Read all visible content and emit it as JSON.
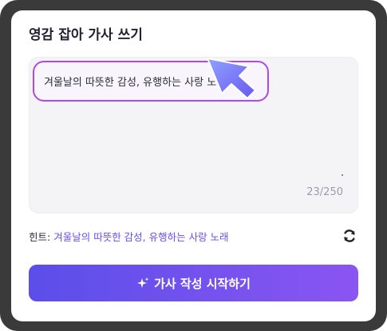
{
  "panel": {
    "title": "영감 잡아 가사 쓰기"
  },
  "lyric_input": {
    "value": "겨울날의 따뜻한 감성, 유행하는 사랑 노래",
    "char_count": "23/250"
  },
  "hint": {
    "label": "힌트:",
    "text": "겨울날의 따뜻한 감성, 유행하는 사랑 노래"
  },
  "start_button": {
    "label": "가사 작성 시작하기"
  },
  "icons": {
    "refresh": "refresh-icon",
    "sparkle": "sparkle-icon",
    "pointer": "pointer-arrow-icon"
  },
  "colors": {
    "accent": "#6a4cf0",
    "input_highlight": "#b049e8",
    "button_start": "#5b4ee9",
    "button_end": "#8a55f2",
    "frame": "#3a3a3a"
  }
}
